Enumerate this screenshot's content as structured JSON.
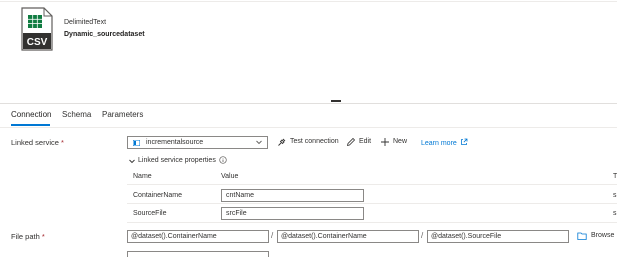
{
  "dataset": {
    "type": "DelimitedText",
    "name": "Dynamic_sourcedataset",
    "icon": "csv-file-icon",
    "icon_text": "CSV"
  },
  "tabs": [
    {
      "label": "Connection",
      "active": true
    },
    {
      "label": "Schema",
      "active": false
    },
    {
      "label": "Parameters",
      "active": false
    }
  ],
  "connection": {
    "linked_service_label": "Linked service",
    "required_mark": "*",
    "linked_service_value": "incrementalsource",
    "actions": {
      "test_connection": "Test connection",
      "edit": "Edit",
      "new": "New",
      "learn_more": "Learn more"
    },
    "properties": {
      "title": "Linked service properties",
      "col_name": "Name",
      "col_value": "Value",
      "col_type_partial": "T",
      "rows": [
        {
          "name": "ContainerName",
          "value": "cntName",
          "type_partial": "s"
        },
        {
          "name": "SourceFile",
          "value": "srcFile",
          "type_partial": "s"
        }
      ]
    },
    "file_path": {
      "label": "File path",
      "container": "@dataset().ContainerName",
      "directory": "@dataset().ContainerName",
      "file": "@dataset().SourceFile",
      "separator": "/",
      "browse_label": "Browse"
    }
  },
  "colors": {
    "accent": "#0078d4",
    "required": "#a4262c",
    "csv_green": "#107c41"
  }
}
